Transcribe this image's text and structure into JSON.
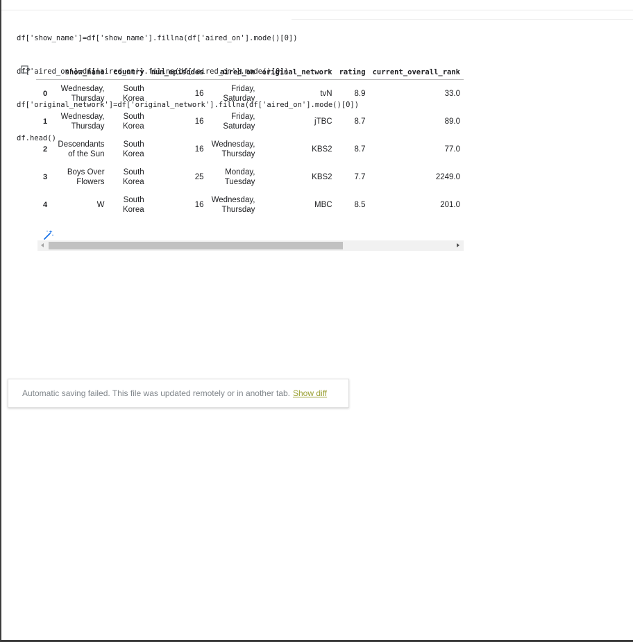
{
  "code_cell": {
    "lines": [
      "df['show_name']=df['show_name'].fillna(df['aired_on'].mode()[0])",
      "df['aired_on']=df['aired_on'].fillna(df['aired_on'].mode()[0])",
      "df['original_network']=df['original_network'].fillna(df['aired_on'].mode()[0])",
      "df.head()"
    ]
  },
  "output": {
    "icon": "output-icon",
    "dataframe": {
      "columns": [
        "",
        "show_name",
        "country",
        "num_episodes",
        "aired_on",
        "original_network",
        "rating",
        "current_overall_rank"
      ],
      "rows": [
        [
          "0",
          "Wednesday, Thursday",
          "South Korea",
          "16",
          "Friday, Saturday",
          "tvN",
          "8.9",
          "33.0"
        ],
        [
          "1",
          "Wednesday, Thursday",
          "South Korea",
          "16",
          "Friday, Saturday",
          "jTBC",
          "8.7",
          "89.0"
        ],
        [
          "2",
          "Descendants of the Sun",
          "South Korea",
          "16",
          "Wednesday, Thursday",
          "KBS2",
          "8.7",
          "77.0"
        ],
        [
          "3",
          "Boys Over Flowers",
          "South Korea",
          "25",
          "Monday, Tuesday",
          "KBS2",
          "7.7",
          "2249.0"
        ],
        [
          "4",
          "W",
          "South Korea",
          "16",
          "Wednesday, Thursday",
          "MBC",
          "8.5",
          "201.0"
        ]
      ]
    },
    "magic_icon": "magic-wand-icon",
    "scrollbar": {
      "position": 0.69
    }
  },
  "toast": {
    "message": "Automatic saving failed. This file was updated remotely or in another tab.",
    "link": "Show diff"
  },
  "colors": {
    "link": "#9aa033",
    "toast_text": "#80868b"
  }
}
